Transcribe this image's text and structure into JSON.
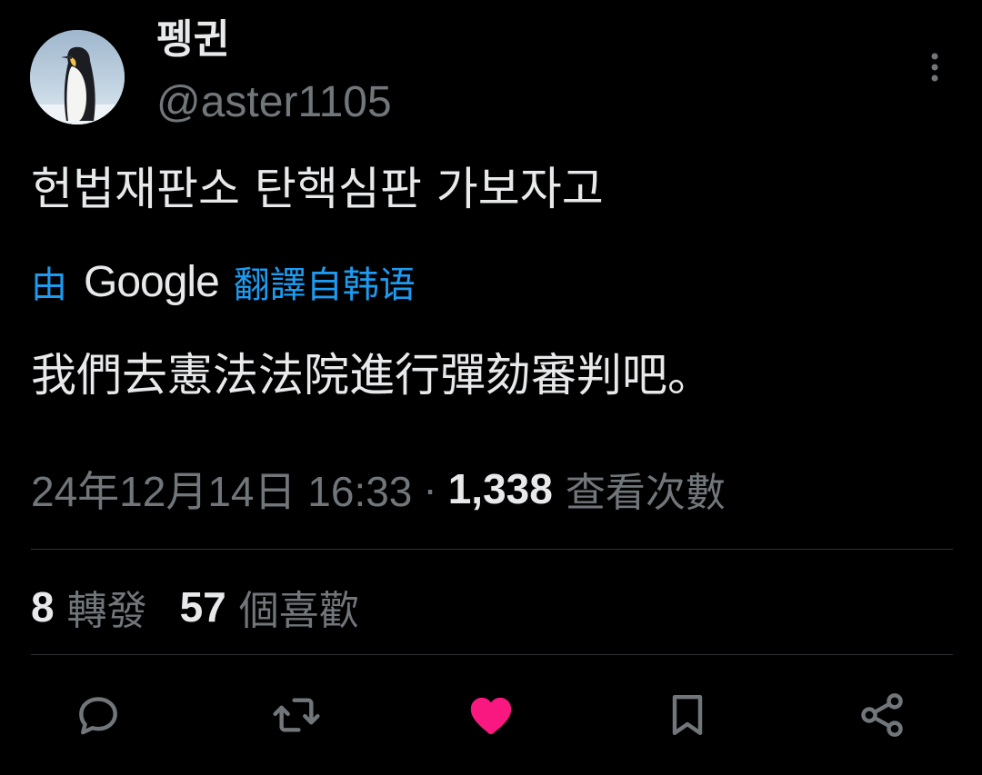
{
  "author": {
    "display_name": "펭귄",
    "handle": "@aster1105"
  },
  "tweet": {
    "text": "헌법재판소 탄핵심판 가보자고",
    "translation": {
      "by_label": "由",
      "provider": "Google",
      "action_label": "翻譯自韩语",
      "text": "我們去憲法法院進行彈劾審判吧。"
    },
    "timestamp": "24年12月14日 16:33",
    "separator": "·",
    "views_count": "1,338",
    "views_label": "查看次數"
  },
  "stats": {
    "retweets_count": "8",
    "retweets_label": "轉發",
    "likes_count": "57",
    "likes_label": "個喜歡"
  },
  "colors": {
    "background": "#000000",
    "text_primary": "#e7e9ea",
    "text_secondary": "#71767b",
    "link": "#1d9bf0",
    "like_active": "#f91880",
    "divider": "#2f3336"
  },
  "icons": {
    "more": "more-vertical-icon",
    "reply": "reply-icon",
    "retweet": "retweet-icon",
    "like": "heart-icon",
    "bookmark": "bookmark-icon",
    "share": "share-icon"
  },
  "state": {
    "liked": true
  }
}
